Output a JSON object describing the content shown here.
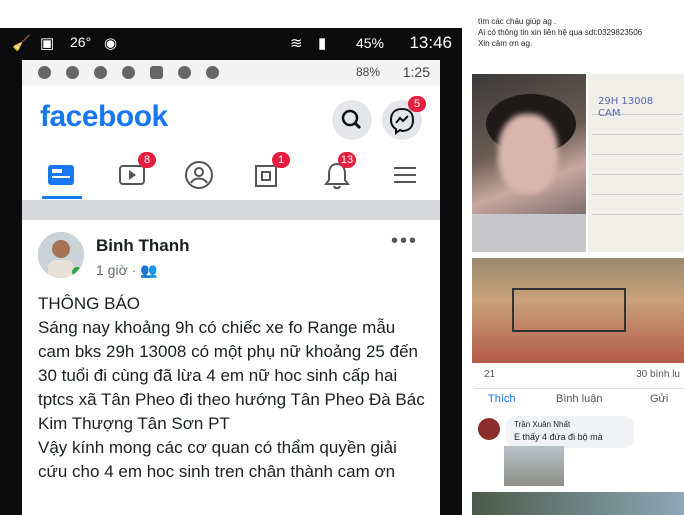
{
  "outer_status": {
    "time": "13:46",
    "battery": "45%",
    "temp": "26°"
  },
  "inner_status": {
    "time": "1:25",
    "battery": "88%"
  },
  "header": {
    "logo": "facebook",
    "messenger_badge": "5"
  },
  "nav": {
    "video_badge": "8",
    "notifications_tab_badge": "1",
    "bell_badge": "13"
  },
  "post": {
    "author": "Binh Thanh",
    "time": "1 giờ · ",
    "body": "THÔNG BÁO\nSáng nay khoảng 9h có chiếc xe fo Range mẫu cam bks 29h 13008 có một phụ nữ khoảng 25 đến 30 tuổi đi cùng đã  lừa 4 em nữ  hoc sinh cấp hai tptcs xã Tân Pheo đi theo hướng Tân Pheo Đà Bác Kim Thượng Tân Sơn PT\n Vậy kính mong các cơ quan có thẩm quyền giải cứu cho 4 em hoc sinh tren chân thành cam ơn"
  },
  "right": {
    "text_line1": "tìm các cháu giúp ag .",
    "text_line2": "Ai có thông tin xin liên hệ qua sdt:0329823506",
    "text_line3": "Xin cảm ơn ag.",
    "note_text": "29H 13008 CAM",
    "likes": "21",
    "shares": "30 bình lu",
    "like_label": "Thích",
    "comment_label": "Bình luận",
    "share_label": "Gửi",
    "commenter": "Trần Xuân Nhất",
    "comment": "E thấy 4 đứa đi bộ mà"
  }
}
